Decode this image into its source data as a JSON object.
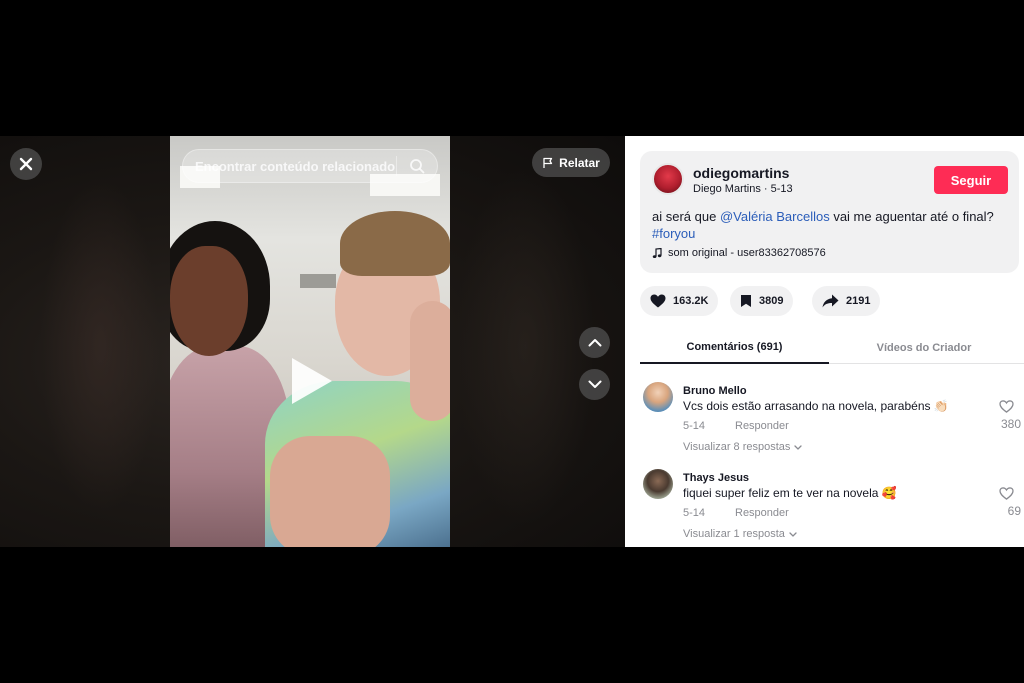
{
  "video": {
    "search_placeholder": "Encontrar conteúdo relacionado",
    "report_label": "Relatar"
  },
  "post": {
    "username": "odiegomartins",
    "display_name": "Diego Martins",
    "date": "5-13",
    "follow_label": "Seguir",
    "description_prefix": "ai será que ",
    "mention": "@Valéria Barcellos",
    "description_suffix": " vai me aguentar até o final?",
    "hashtag": "#foryou",
    "music": "som original - user83362708576"
  },
  "actions": {
    "likes": "163.2K",
    "saves": "3809",
    "shares": "2191"
  },
  "tabs": {
    "comments": "Comentários (691)",
    "creator": "Vídeos do Criador"
  },
  "comments": [
    {
      "name": "Bruno Mello",
      "text": "Vcs dois estão arrasando na novela, parabéns 👏🏻",
      "date": "5-14",
      "reply": "Responder",
      "more": "Visualizar 8 respostas",
      "likes": "380"
    },
    {
      "name": "Thays Jesus",
      "text": "fiquei super feliz em te ver na novela 🥰",
      "date": "5-14",
      "reply": "Responder",
      "more": "Visualizar 1 resposta",
      "likes": "69"
    }
  ],
  "colors": {
    "accent": "#fe2c55",
    "link": "#2b5db9",
    "muted": "#8a8b91",
    "card_bg": "#f1f1f2"
  }
}
